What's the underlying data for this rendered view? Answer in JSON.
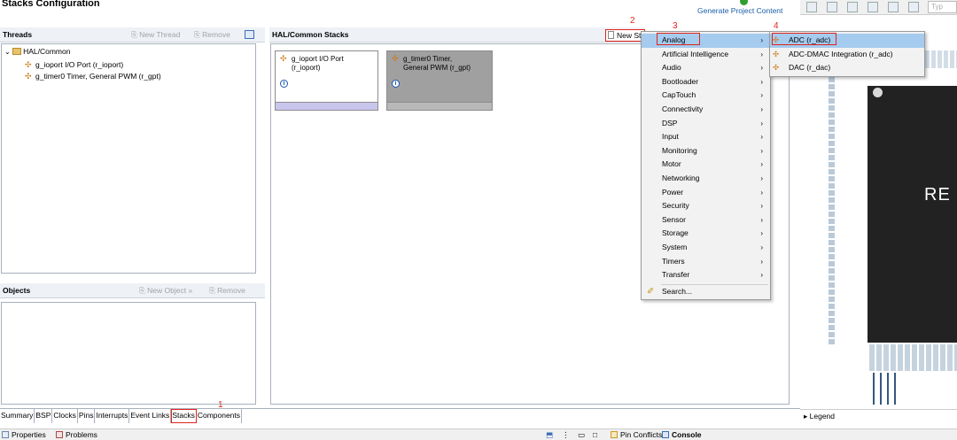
{
  "title": "Stacks Configuration",
  "generate_label": "Generate Project Content",
  "threads": {
    "header": "Threads",
    "new_thread": "New Thread",
    "remove": "Remove",
    "tree": [
      "HAL/Common",
      "g_ioport I/O Port (r_ioport)",
      "g_timer0 Timer, General PWM (r_gpt)"
    ]
  },
  "objects": {
    "header": "Objects",
    "new_object": "New Object »",
    "remove": "Remove"
  },
  "stacks_panel": {
    "header": "HAL/Common Stacks",
    "new_stack_btn": "New St",
    "cards": [
      {
        "label": "g_ioport I/O Port\n(r_ioport)"
      },
      {
        "label": "g_timer0 Timer,\nGeneral PWM (r_gpt)"
      }
    ]
  },
  "new_stack_menu": [
    "Analog",
    "Artificial Intelligence",
    "Audio",
    "Bootloader",
    "CapTouch",
    "Connectivity",
    "DSP",
    "Input",
    "Monitoring",
    "Motor",
    "Networking",
    "Power",
    "Security",
    "Sensor",
    "Storage",
    "System",
    "Timers",
    "Transfer"
  ],
  "search_item": "Search...",
  "analog_submenu": [
    "ADC (r_adc)",
    "ADC-DMAC Integration (r_adc)",
    "DAC (r_dac)"
  ],
  "annotations": [
    "1",
    "2",
    "3",
    "4"
  ],
  "bottom_tabs": [
    "Summary",
    "BSP",
    "Clocks",
    "Pins",
    "Interrupts",
    "Event Links",
    "Stacks",
    "Components"
  ],
  "legend": "Legend",
  "statusbar": {
    "properties": "Properties",
    "problems": "Problems",
    "pin_conflicts": "Pin Conflicts",
    "console": "Console"
  },
  "chip_text": "RE",
  "type_placeholder": "Typ",
  "colors": {
    "highlight": "#a5cbef",
    "annotation_red": "#e0241b",
    "card_selected": "#a0a0a0",
    "card_bar": "#c9c6ee",
    "link_blue": "#1a5ea8"
  }
}
